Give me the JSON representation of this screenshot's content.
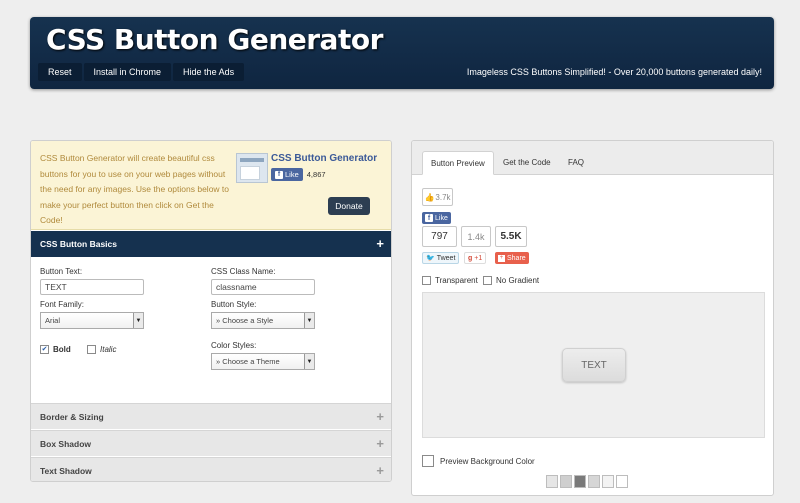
{
  "header": {
    "title": "CSS Button Generator",
    "nav": [
      "Reset",
      "Install in Chrome",
      "Hide the Ads"
    ],
    "tagline": "Imageless CSS Buttons Simplified! - Over 20,000 buttons generated daily!"
  },
  "intro": {
    "description": "CSS Button Generator will create beautiful css buttons for you to use on your web pages without the need for any images. Use the options below to make your perfect button then click on Get the Code!",
    "fb_page_name": "CSS Button Generator",
    "fb_like_label": "Like",
    "fb_like_count": "4,867",
    "donate_label": "Donate"
  },
  "sections": {
    "basics": "CSS Button Basics",
    "border": "Border & Sizing",
    "box_shadow": "Box Shadow",
    "text_shadow": "Text Shadow"
  },
  "form": {
    "button_text_label": "Button Text:",
    "button_text_value": "TEXT",
    "class_name_label": "CSS Class Name:",
    "class_name_value": "classname",
    "font_family_label": "Font Family:",
    "font_family_value": "Arial",
    "button_style_label": "Button Style:",
    "button_style_value": "» Choose a Style",
    "bold_label": "Bold",
    "italic_label": "Italic",
    "color_styles_label": "Color Styles:",
    "color_styles_value": "» Choose a Theme",
    "bold_checked": true,
    "italic_checked": false
  },
  "preview": {
    "tabs": [
      "Button Preview",
      "Get the Code",
      "FAQ"
    ],
    "active_tab": 0,
    "thumbs_count": "3.7k",
    "fb_like_label": "Like",
    "tweet_count": "797",
    "gplus_count": "1.4k",
    "share_count": "5.5K",
    "tweet_label": "Tweet",
    "gplus_label": "+1",
    "share_label": "Share",
    "transparent_label": "Transparent",
    "no_gradient_label": "No Gradient",
    "button_text": "TEXT",
    "bg_color_label": "Preview Background Color",
    "swatches": [
      "#e6e6e6",
      "#cfcfcf",
      "#7a7a7a",
      "#d6d6d6",
      "#f3f3f3",
      "#ffffff"
    ]
  },
  "colors": {
    "header_bg": "#15314f",
    "intro_bg": "#fbf4d6",
    "intro_text": "#b08a3c",
    "facebook": "#4a66a0",
    "gplus": "#d34836",
    "twitter": "#2aa9e0"
  }
}
